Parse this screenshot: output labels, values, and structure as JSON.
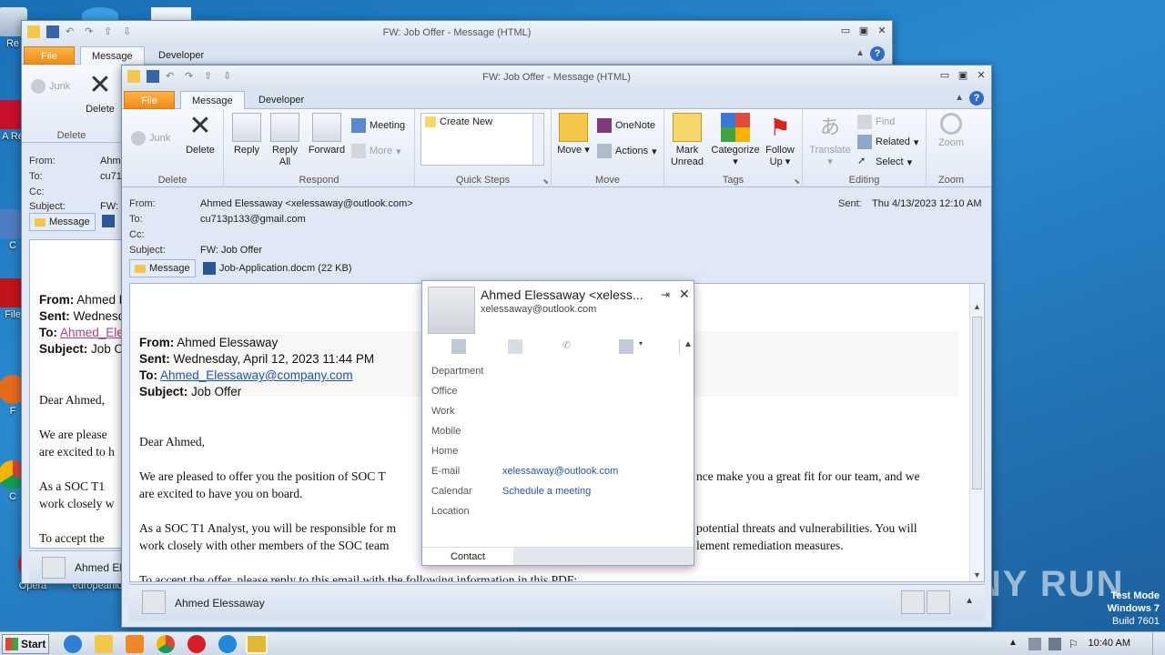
{
  "desktop": {
    "icons": [
      {
        "label": "Re"
      },
      {
        "label": "A Re"
      },
      {
        "label": "C"
      },
      {
        "label": "File"
      },
      {
        "label": "F"
      },
      {
        "label": "C"
      },
      {
        "label": "Opera"
      },
      {
        "label": "europeanlo"
      }
    ],
    "watermark": "ANY RUN",
    "testmode": {
      "line1": "Test Mode",
      "line2": "Windows 7",
      "line3": "Build 7601"
    }
  },
  "back_window": {
    "title": "FW:  Job Offer  -  Message (HTML)",
    "tabs": [
      "File",
      "Message",
      "Developer"
    ],
    "ribbon": {
      "junk": "Junk",
      "delete": "Delete",
      "group_delete": "Delete"
    },
    "header": {
      "from_label": "From:",
      "from_val": "Ahm",
      "to_label": "To:",
      "to_val": "cu71",
      "cc_label": "Cc:",
      "subject_label": "Subject:",
      "subject_val": "FW:"
    },
    "message_chip": "Message",
    "body": {
      "from": "From:",
      "from_val": "Ahmed E",
      "sent": "Sent:",
      "sent_val": "Wednesd",
      "to": "To:",
      "to_val": "Ahmed_Ele",
      "subject": "Subject:",
      "subject_val": "Job Of",
      "dear": "Dear Ahmed,",
      "p1a": "We are please",
      "p1b": "are excited to h",
      "p2a": "As a SOC T1",
      "p2b": "work closely w",
      "p3": "To accept the"
    },
    "bottom_name": "Ahmed El"
  },
  "front_window": {
    "title": "FW:  Job Offer  -  Message (HTML)",
    "tabs": [
      "File",
      "Message",
      "Developer"
    ],
    "ribbon": {
      "junk": "Junk",
      "delete": "Delete",
      "reply": "Reply",
      "reply_all_1": "Reply",
      "reply_all_2": "All",
      "forward": "Forward",
      "meeting": "Meeting",
      "more": "More",
      "create_new": "Create New",
      "move": "Move",
      "onenote": "OneNote",
      "actions": "Actions",
      "mark_unread_1": "Mark",
      "mark_unread_2": "Unread",
      "categorize": "Categorize",
      "follow_up_1": "Follow",
      "follow_up_2": "Up",
      "translate": "Translate",
      "find": "Find",
      "related": "Related",
      "select": "Select",
      "zoom": "Zoom",
      "groups": [
        "Delete",
        "Respond",
        "Quick Steps",
        "Move",
        "Tags",
        "Editing",
        "Zoom"
      ]
    },
    "header": {
      "from_label": "From:",
      "from_val": "Ahmed Elessaway <xelessaway@outlook.com>",
      "to_label": "To:",
      "to_val": "cu713p133@gmail.com",
      "cc_label": "Cc:",
      "subject_label": "Subject:",
      "subject_val": "FW:  Job Offer",
      "sent_label": "Sent:",
      "sent_val": "Thu 4/13/2023 12:10 AM"
    },
    "attachments": {
      "message": "Message",
      "file": "Job-Application.docm (22 KB)"
    },
    "body": {
      "from": "From:",
      "from_val": " Ahmed Elessaway",
      "sent": "Sent:",
      "sent_val": " Wednesday, April 12, 2023 11:44 PM",
      "to": "To:",
      "to_val": "Ahmed_Elessaway@company.com",
      "subject": "Subject:",
      "subject_val": " Job Offer",
      "dear": "Dear Ahmed,",
      "p1a_left": "We are pleased to offer you the position of SOC T",
      "p1a_right": "nce make you a great fit for our team, and we",
      "p1b": "are excited to have you on board.",
      "p2a_left": "As a SOC T1 Analyst, you will be responsible for m",
      "p2a_right": "potential threats and vulnerabilities.  You will",
      "p2b_left": "work closely with other members of the SOC team",
      "p2b_right": "lement remediation measures.",
      "p3": "To accept the offer, please reply to this email with the following information in this PDF:"
    },
    "bottom_name": "Ahmed Elessaway"
  },
  "contact_card": {
    "name": "Ahmed Elessaway <xeless...",
    "email_sub": "xelessaway@outlook.com",
    "rows": [
      {
        "label": "Department",
        "value": ""
      },
      {
        "label": "Office",
        "value": ""
      },
      {
        "label": "Work",
        "value": ""
      },
      {
        "label": "Mobile",
        "value": ""
      },
      {
        "label": "Home",
        "value": ""
      },
      {
        "label": "E-mail",
        "value": "xelessaway@outlook.com"
      },
      {
        "label": "Calendar",
        "value": "Schedule a meeting"
      },
      {
        "label": "Location",
        "value": ""
      }
    ],
    "footer_tab": "Contact"
  },
  "taskbar": {
    "start": "Start",
    "clock": "10:40 AM"
  }
}
